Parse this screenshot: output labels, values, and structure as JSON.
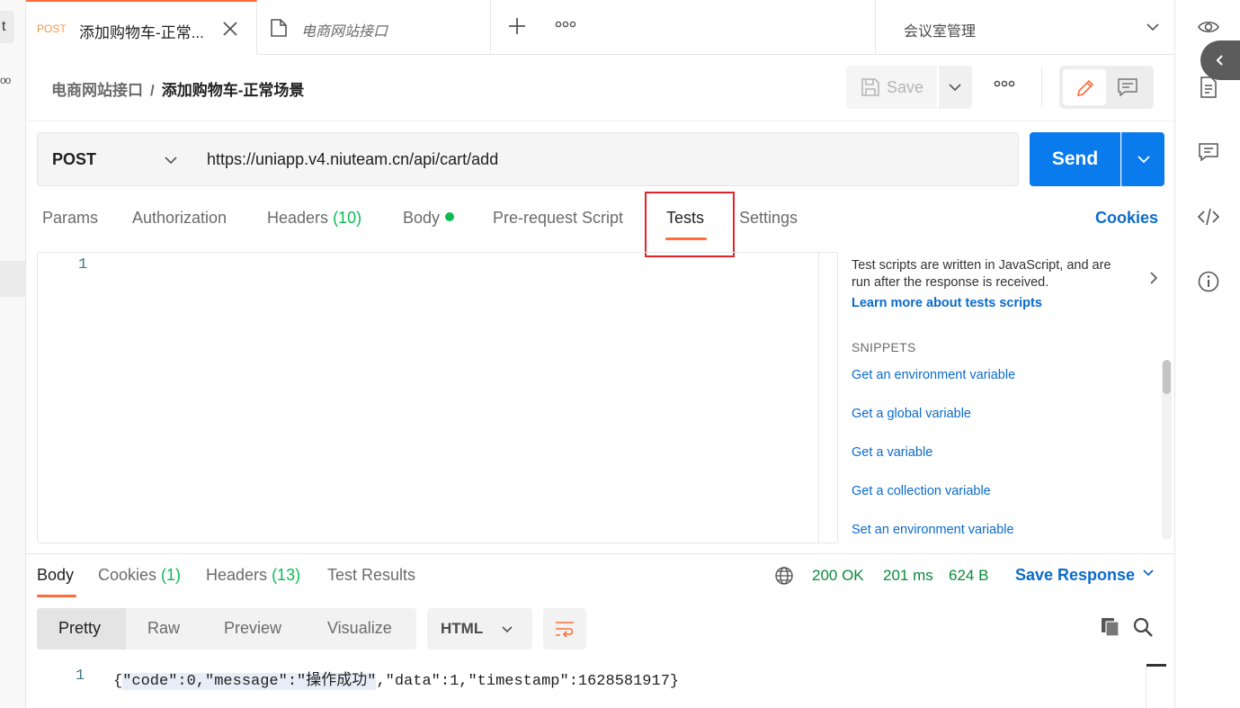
{
  "tabs": [
    {
      "method": "POST",
      "name": "添加购物车-正常..."
    },
    {
      "name": "电商网站接口"
    }
  ],
  "environment": {
    "selected": "会议室管理"
  },
  "breadcrumb": {
    "collection": "电商网站接口",
    "separator": "/",
    "request": "添加购物车-正常场景"
  },
  "toolbar": {
    "save_label": "Save"
  },
  "request": {
    "method": "POST",
    "url": "https://uniapp.v4.niuteam.cn/api/cart/add",
    "send_label": "Send"
  },
  "request_tabs": {
    "params": "Params",
    "authorization": "Authorization",
    "headers": "Headers",
    "headers_count": "(10)",
    "body": "Body",
    "pre_request": "Pre-request Script",
    "tests": "Tests",
    "settings": "Settings",
    "cookies": "Cookies"
  },
  "editor": {
    "line_number": "1"
  },
  "snippets": {
    "intro": "Test scripts are written in JavaScript, and are run after the response is received.",
    "learn_more": "Learn more about tests scripts",
    "title": "SNIPPETS",
    "items": [
      "Get an environment variable",
      "Get a global variable",
      "Get a variable",
      "Get a collection variable",
      "Set an environment variable"
    ]
  },
  "response_tabs": {
    "body": "Body",
    "cookies": "Cookies",
    "cookies_count": "(1)",
    "headers": "Headers",
    "headers_count": "(13)",
    "test_results": "Test Results"
  },
  "response_status": {
    "status": "200 OK",
    "time": "201 ms",
    "size": "624 B",
    "save": "Save Response"
  },
  "response_view": {
    "pretty": "Pretty",
    "raw": "Raw",
    "preview": "Preview",
    "visualize": "Visualize",
    "format": "HTML"
  },
  "response_body": {
    "line_number": "1",
    "open": "{",
    "highlighted": "\"code\":0,\"message\":\"操作成功\"",
    "rest": ",\"data\":1,\"timestamp\":1628581917}"
  },
  "sidebar": {
    "chip": "t",
    "dots": "oo"
  },
  "colors": {
    "accent": "#ff6c37",
    "primary": "#097bed",
    "success": "#0cbb52",
    "link": "#0b6bcb",
    "highlight_box": "#e2232a"
  },
  "icons": [
    "close-icon",
    "collection-icon",
    "plus-icon",
    "more-icon",
    "chevron-down-icon",
    "eye-icon",
    "save-icon",
    "pencil-icon",
    "comment-icon",
    "document-icon",
    "code-icon",
    "info-icon",
    "chevron-left-icon",
    "chevron-right-icon",
    "globe-icon",
    "wrap-icon",
    "copy-icon",
    "search-icon"
  ]
}
